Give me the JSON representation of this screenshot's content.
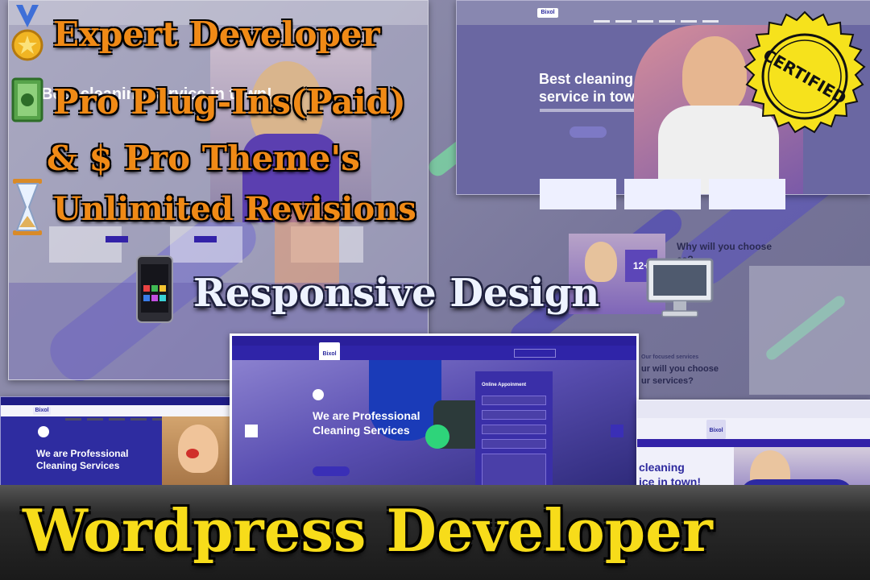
{
  "headline": {
    "line1": "Expert Developer",
    "line2": "Pro Plug-Ins(Paid)",
    "line3": "& $ Pro Theme's",
    "line4": "Unlimited Revisions"
  },
  "subheadline": "Responsive Design",
  "footer_title": "Wordpress  Developer",
  "seal_text": "CERTIFIED",
  "mockups": {
    "tablet_hero": "Best cleaning service in town!",
    "top_right_hero": "Best cleaning service in town!",
    "center_hero_line1": "We are Professional",
    "center_hero_line2": "Cleaning Services",
    "center_form_title": "Online Appoinment",
    "left_hero_line1": "We are Professional",
    "left_hero_line2": "Cleaning Services",
    "right_hero_line1": "cleaning",
    "right_hero_line2": "ice in town!",
    "right_badge": "12+",
    "mid_right_heading_1": "Why will you choose",
    "mid_right_heading_2": "es?",
    "lower_right_heading_1": "Our focused services",
    "lower_right_heading_2": "ur will you choose",
    "lower_right_heading_3": "ur services?",
    "logo": "Bixol"
  },
  "icons": [
    "medal-icon",
    "money-icon",
    "dollar-icon",
    "hourglass-icon",
    "mobile-phone-icon",
    "desktop-monitor-icon"
  ],
  "colors": {
    "orange": "#f08a16",
    "gold": "#f7dc1a",
    "brand_purple": "#3322a8",
    "seal_yellow": "#f6e21c"
  }
}
